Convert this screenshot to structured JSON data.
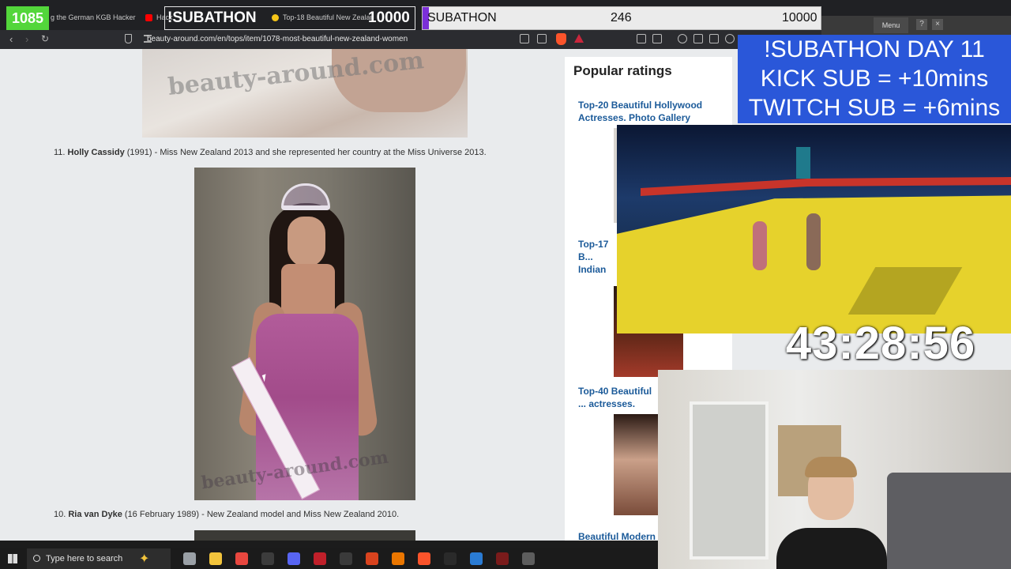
{
  "browser": {
    "tabs": [
      {
        "label": "g the German KGB Hacker",
        "color": "#e8473f"
      },
      {
        "label": "Hack",
        "color": "#ff0000"
      },
      {
        "label": "Top-18 Beautiful New Zealand",
        "color": "#f5c518"
      }
    ],
    "url": "beauty-around.com/en/tops/item/1078-most-beautiful-new-zealand-women"
  },
  "article": {
    "items": [
      {
        "number": "11.",
        "name": "Holly Cassidy",
        "details": "(1991) - Miss New Zealand 2013 and she represented her country at the Miss Universe 2013."
      },
      {
        "number": "10.",
        "name": "Ria van Dyke",
        "details": "(16 February 1989) - New Zealand model and Miss New Zealand 2010."
      }
    ],
    "watermark": "beauty-around.com"
  },
  "sidebar": {
    "heading": "Popular ratings",
    "links": [
      {
        "title": "Top-20 Beautiful Hollywood Actresses. Photo Gallery"
      },
      {
        "title": "Top-17 B... Indian A... Gallery"
      },
      {
        "title": "Top-40 Beautiful ... actresses. Photo"
      },
      {
        "title": "Beautiful Modern"
      }
    ]
  },
  "overlay": {
    "sub_count": "1085",
    "subathon_label": "!SUBATHON",
    "goal_current_small": "10000",
    "goal_bar": {
      "label": "SUBATHON",
      "current": "246",
      "target": "10000",
      "progress": 0.0246
    },
    "announcement": [
      "!SUBATHON DAY 11",
      "KICK SUB = +10mins",
      "TWITCH SUB = +6mins"
    ],
    "timer": "43:28:56",
    "menu_label": "Menu"
  },
  "taskbar": {
    "search_placeholder": "Type here to search",
    "apps": [
      {
        "icon": "task-view-icon",
        "color": "#9aa0a6"
      },
      {
        "icon": "file-explorer-icon",
        "color": "#f2c43c"
      },
      {
        "icon": "chrome-icon",
        "color": "#e8473f"
      },
      {
        "icon": "obs-icon",
        "color": "#3c3c3c"
      },
      {
        "icon": "discord-icon",
        "color": "#5865f2"
      },
      {
        "icon": "voicemeeter-icon",
        "color": "#c0202a"
      },
      {
        "icon": "x-app-icon",
        "color": "#3a3a3a"
      },
      {
        "icon": "app-red-icon",
        "color": "#d9431e"
      },
      {
        "icon": "blender-icon",
        "color": "#ea7600"
      },
      {
        "icon": "brave-icon",
        "color": "#fb542b"
      },
      {
        "icon": "capcut-icon",
        "color": "#2a2a2a"
      },
      {
        "icon": "vscode-icon",
        "color": "#2a7bd3"
      },
      {
        "icon": "x-red-app-icon",
        "color": "#7a1b1b"
      },
      {
        "icon": "runelite-icon",
        "color": "#5d5d5d"
      }
    ]
  }
}
